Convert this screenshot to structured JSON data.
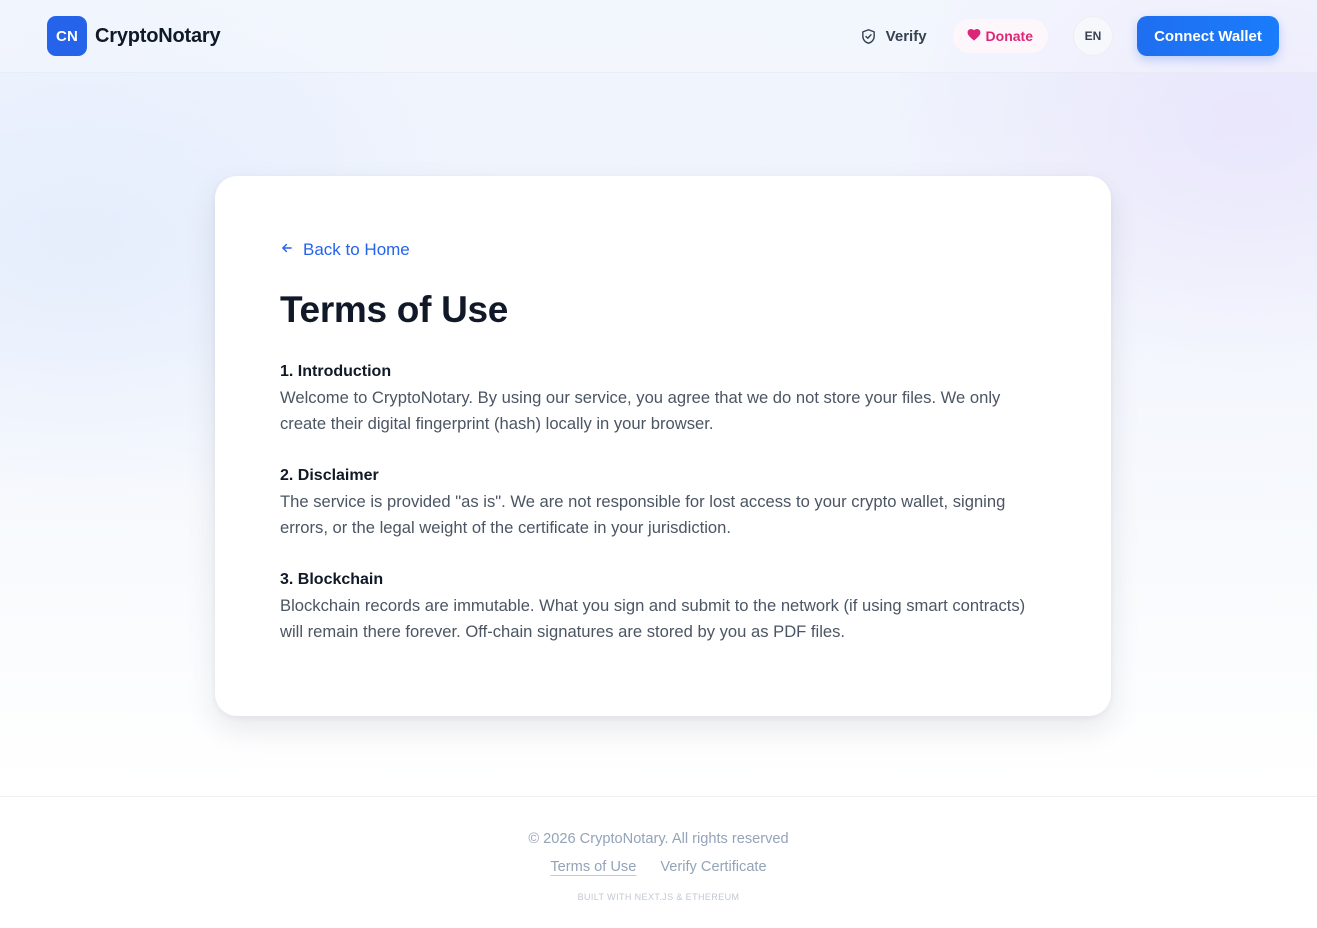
{
  "header": {
    "logo_text": "CN",
    "brand_name": "CryptoNotary",
    "verify_label": "Verify",
    "donate_label": "Donate",
    "language": "EN",
    "connect_label": "Connect Wallet"
  },
  "main": {
    "back_label": "Back to Home",
    "title": "Terms of Use",
    "sections": [
      {
        "heading": "1. Introduction",
        "body": "Welcome to CryptoNotary. By using our service, you agree that we do not store your files. We only create their digital fingerprint (hash) locally in your browser."
      },
      {
        "heading": "2. Disclaimer",
        "body": "The service is provided \"as is\". We are not responsible for lost access to your crypto wallet, signing errors, or the legal weight of the certificate in your jurisdiction."
      },
      {
        "heading": "3. Blockchain",
        "body": "Blockchain records are immutable. What you sign and submit to the network (if using smart contracts) will remain there forever. Off-chain signatures are stored by you as PDF files."
      }
    ]
  },
  "footer": {
    "copyright": "© 2026 CryptoNotary. All rights reserved",
    "links": [
      "Terms of Use",
      "Verify Certificate"
    ],
    "built_with": "Built with Next.js & Ethereum"
  },
  "icons": {
    "verify": "shield-check-icon",
    "donate": "heart-icon",
    "back": "arrow-left-icon"
  },
  "colors": {
    "accent": "#2563eb",
    "donate": "#db2777",
    "heading": "#111827",
    "body_text": "#4b5563",
    "muted": "#94a3b8"
  }
}
